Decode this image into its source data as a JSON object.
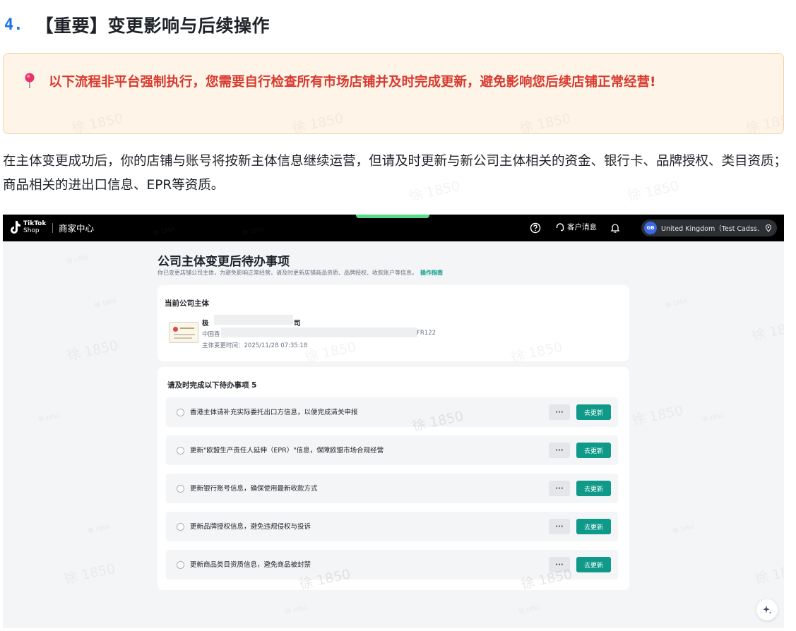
{
  "section": {
    "number": "4.",
    "title": "【重要】变更影响与后续操作"
  },
  "callout": {
    "icon": "pin-icon",
    "text": "以下流程非平台强制执行，您需要自行检查所有市场店铺并及时完成更新，避免影响您后续店铺正常经营!"
  },
  "paragraph": "在主体变更成功后，你的店铺与账号将按新主体信息继续运营，但请及时更新与新公司主体相关的资金、银行卡、品牌授权、类目资质；商品相关的进出口信息、EPR等资质。",
  "watermark": "徐 1850",
  "app": {
    "brand_top": "TikTok",
    "brand_bottom": "Shop",
    "nav_title": "商家中心",
    "customer_messages": "客户消息",
    "avatar_initials": "GB",
    "store_selector": "United Kingdom（Test Cadss...",
    "page_title": "公司主体变更后待办事项",
    "page_subtitle": "你已变更店铺公司主体，为避免影响正常经营，请及时更新店铺商品资质、品牌授权、收款账户等信息。",
    "guide_link": "操作指南",
    "entity_card": {
      "heading": "当前公司主体",
      "name_start": "极",
      "name_end": "司",
      "reg_start": "中国香",
      "reg_end": "FR122",
      "change_time": "主体变更时间：2025/11/28 07:35:18"
    },
    "todo": {
      "heading": "请及时完成以下待办事项 5",
      "more_label": "···",
      "action_label": "去更新",
      "items": [
        {
          "text": "香港主体请补充实际委托出口方信息，以便完成清关申报"
        },
        {
          "text": "更新\"欧盟生产责任人延伸（EPR）\"信息，保障欧盟市场合规经营"
        },
        {
          "text": "更新银行账号信息，确保使用最新收款方式"
        },
        {
          "text": "更新品牌授权信息，避免违规侵权与投诉"
        },
        {
          "text": "更新商品类目资质信息，避免商品被封禁"
        }
      ]
    }
  },
  "colors": {
    "accent_blue": "#1a73e8",
    "warning_red": "#d83a2e",
    "callout_bg": "#fff4e8",
    "primary_teal": "#0f9988"
  }
}
